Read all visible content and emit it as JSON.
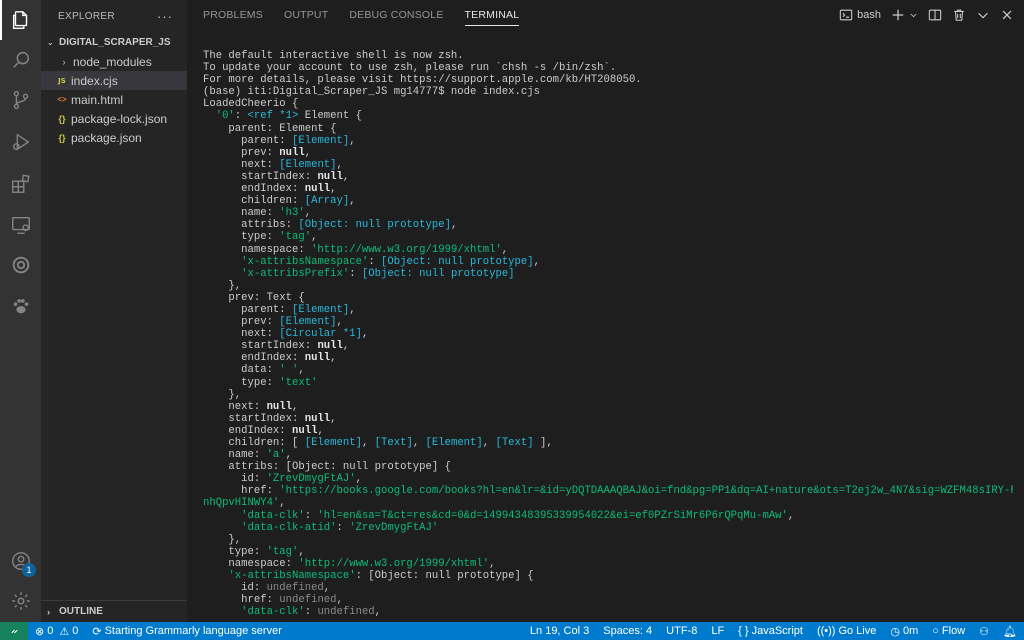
{
  "activity": {
    "items": [
      "explorer-icon",
      "search-icon",
      "source-control-icon",
      "run-debug-icon",
      "extensions-icon",
      "remote-explorer-icon",
      "gitlens-icon",
      "paw-icon"
    ],
    "account_badge": "1"
  },
  "sidebar": {
    "title": "EXPLORER",
    "more": "···",
    "folder": "DIGITAL_SCRAPER_JS",
    "items": [
      {
        "icon": "›",
        "label": "node_modules"
      },
      {
        "icon": "JS",
        "label": "index.cjs"
      },
      {
        "icon": "<>",
        "label": "main.html"
      },
      {
        "icon": "{}",
        "label": "package-lock.json"
      },
      {
        "icon": "{}",
        "label": "package.json"
      }
    ],
    "outline": "OUTLINE"
  },
  "panel": {
    "tabs": [
      "PROBLEMS",
      "OUTPUT",
      "DEBUG CONSOLE",
      "TERMINAL"
    ],
    "shell": "bash"
  },
  "terminal": {
    "lines": [
      [
        [
          "",
          "The default interactive shell is now zsh."
        ]
      ],
      [
        [
          "",
          "To update your account to use zsh, please run `chsh -s /bin/zsh`."
        ]
      ],
      [
        [
          "",
          "For more details, please visit https://support.apple.com/kb/HT208050."
        ]
      ],
      [
        [
          "",
          "(base) iti:Digital_Scraper_JS mg14777$ node index.cjs"
        ]
      ],
      [
        [
          "",
          "LoadedCheerio {"
        ]
      ],
      [
        [
          "",
          "  "
        ],
        [
          "g",
          "'0'"
        ],
        [
          "",
          ": "
        ],
        [
          "c",
          "<ref *1>"
        ],
        [
          "",
          " Element {"
        ]
      ],
      [
        [
          "",
          "    parent: Element {"
        ]
      ],
      [
        [
          "",
          "      parent: "
        ],
        [
          "c",
          "[Element]"
        ],
        [
          "",
          ","
        ]
      ],
      [
        [
          "",
          "      prev: "
        ],
        [
          "b",
          "null"
        ],
        [
          "",
          ","
        ]
      ],
      [
        [
          "",
          "      next: "
        ],
        [
          "c",
          "[Element]"
        ],
        [
          "",
          ","
        ]
      ],
      [
        [
          "",
          "      startIndex: "
        ],
        [
          "b",
          "null"
        ],
        [
          "",
          ","
        ]
      ],
      [
        [
          "",
          "      endIndex: "
        ],
        [
          "b",
          "null"
        ],
        [
          "",
          ","
        ]
      ],
      [
        [
          "",
          "      children: "
        ],
        [
          "c",
          "[Array]"
        ],
        [
          "",
          ","
        ]
      ],
      [
        [
          "",
          "      name: "
        ],
        [
          "g",
          "'h3'"
        ],
        [
          "",
          ","
        ]
      ],
      [
        [
          "",
          "      attribs: "
        ],
        [
          "c",
          "[Object: null prototype]"
        ],
        [
          "",
          ","
        ]
      ],
      [
        [
          "",
          "      type: "
        ],
        [
          "g",
          "'tag'"
        ],
        [
          "",
          ","
        ]
      ],
      [
        [
          "",
          "      namespace: "
        ],
        [
          "g",
          "'http://www.w3.org/1999/xhtml'"
        ],
        [
          "",
          ","
        ]
      ],
      [
        [
          "",
          "      "
        ],
        [
          "g",
          "'x-attribsNamespace'"
        ],
        [
          "",
          ": "
        ],
        [
          "c",
          "[Object: null prototype]"
        ],
        [
          "",
          ","
        ]
      ],
      [
        [
          "",
          "      "
        ],
        [
          "g",
          "'x-attribsPrefix'"
        ],
        [
          "",
          ": "
        ],
        [
          "c",
          "[Object: null prototype]"
        ]
      ],
      [
        [
          "",
          "    },"
        ]
      ],
      [
        [
          "",
          "    prev: Text {"
        ]
      ],
      [
        [
          "",
          "      parent: "
        ],
        [
          "c",
          "[Element]"
        ],
        [
          "",
          ","
        ]
      ],
      [
        [
          "",
          "      prev: "
        ],
        [
          "c",
          "[Element]"
        ],
        [
          "",
          ","
        ]
      ],
      [
        [
          "",
          "      next: "
        ],
        [
          "c",
          "[Circular *1]"
        ],
        [
          "",
          ","
        ]
      ],
      [
        [
          "",
          "      startIndex: "
        ],
        [
          "b",
          "null"
        ],
        [
          "",
          ","
        ]
      ],
      [
        [
          "",
          "      endIndex: "
        ],
        [
          "b",
          "null"
        ],
        [
          "",
          ","
        ]
      ],
      [
        [
          "",
          "      data: "
        ],
        [
          "g",
          "' '"
        ],
        [
          "",
          ","
        ]
      ],
      [
        [
          "",
          "      type: "
        ],
        [
          "g",
          "'text'"
        ]
      ],
      [
        [
          "",
          "    },"
        ]
      ],
      [
        [
          "",
          "    next: "
        ],
        [
          "b",
          "null"
        ],
        [
          "",
          ","
        ]
      ],
      [
        [
          "",
          "    startIndex: "
        ],
        [
          "b",
          "null"
        ],
        [
          "",
          ","
        ]
      ],
      [
        [
          "",
          "    endIndex: "
        ],
        [
          "b",
          "null"
        ],
        [
          "",
          ","
        ]
      ],
      [
        [
          "",
          "    children: [ "
        ],
        [
          "c",
          "[Element]"
        ],
        [
          "",
          ", "
        ],
        [
          "c",
          "[Text]"
        ],
        [
          "",
          ", "
        ],
        [
          "c",
          "[Element]"
        ],
        [
          "",
          ", "
        ],
        [
          "c",
          "[Text]"
        ],
        [
          "",
          " ],"
        ]
      ],
      [
        [
          "",
          "    name: "
        ],
        [
          "g",
          "'a'"
        ],
        [
          "",
          ","
        ]
      ],
      [
        [
          "",
          "    attribs: [Object: null prototype] {"
        ]
      ],
      [
        [
          "",
          "      id: "
        ],
        [
          "g",
          "'ZrevDmygFtAJ'"
        ],
        [
          "",
          ","
        ]
      ],
      [
        [
          "",
          "      href: "
        ],
        [
          "g",
          "'https://books.google.com/books?hl=en&lr=&id=yDQTDAAAQBAJ&oi=fnd&pg=PP1&dq=AI+nature&ots=T2ej2w_4N7&sig=WZFM48sIRY-FuUuF"
        ]
      ],
      [
        [
          "g",
          "nhQpvHINWY4'"
        ],
        [
          "",
          ","
        ]
      ],
      [
        [
          "",
          "      "
        ],
        [
          "g",
          "'data-clk'"
        ],
        [
          "",
          ": "
        ],
        [
          "g",
          "'hl=en&sa=T&ct=res&cd=0&d=14994348395339954022&ei=ef0PZrSiMr6P6rQPqMu-mAw'"
        ],
        [
          "",
          ","
        ]
      ],
      [
        [
          "",
          "      "
        ],
        [
          "g",
          "'data-clk-atid'"
        ],
        [
          "",
          ": "
        ],
        [
          "g",
          "'ZrevDmygFtAJ'"
        ]
      ],
      [
        [
          "",
          "    },"
        ]
      ],
      [
        [
          "",
          "    type: "
        ],
        [
          "g",
          "'tag'"
        ],
        [
          "",
          ","
        ]
      ],
      [
        [
          "",
          "    namespace: "
        ],
        [
          "g",
          "'http://www.w3.org/1999/xhtml'"
        ],
        [
          "",
          ","
        ]
      ],
      [
        [
          "",
          "    "
        ],
        [
          "g",
          "'x-attribsNamespace'"
        ],
        [
          "",
          ": [Object: null prototype] {"
        ]
      ],
      [
        [
          "",
          "      id: "
        ],
        [
          "d",
          "undefined"
        ],
        [
          "",
          ","
        ]
      ],
      [
        [
          "",
          "      href: "
        ],
        [
          "d",
          "undefined"
        ],
        [
          "",
          ","
        ]
      ],
      [
        [
          "",
          "      "
        ],
        [
          "g",
          "'data-clk'"
        ],
        [
          "",
          ": "
        ],
        [
          "d",
          "undefined"
        ],
        [
          "",
          ","
        ]
      ]
    ]
  },
  "status": {
    "errors": "0",
    "warnings": "0",
    "grammarly": "Starting Grammarly language server",
    "position": "Ln 19, Col 3",
    "spaces": "Spaces: 4",
    "encoding": "UTF-8",
    "eol": "LF",
    "braces": "{ }",
    "language": "JavaScript",
    "golive": "Go Live",
    "time": "0m",
    "flow": "Flow"
  },
  "colors": {
    "accent": "#007acc",
    "remote": "#16825d",
    "string": "#0dbc79",
    "special": "#29b8db"
  }
}
